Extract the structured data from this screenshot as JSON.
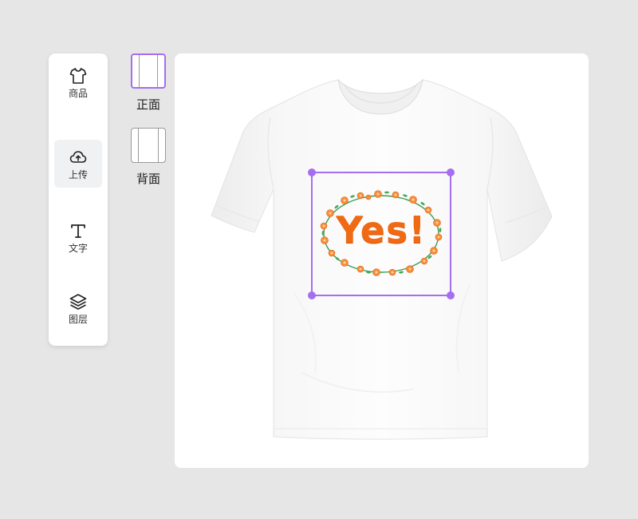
{
  "toolbar": {
    "items": [
      {
        "label": "商品",
        "icon": "tshirt-icon"
      },
      {
        "label": "上传",
        "icon": "cloud-upload-icon",
        "active": true
      },
      {
        "label": "文字",
        "icon": "text-icon"
      },
      {
        "label": "图层",
        "icon": "layers-icon"
      }
    ]
  },
  "sides": {
    "front_label": "正面",
    "back_label": "背面",
    "selected": "front"
  },
  "design": {
    "text": "Yes!",
    "text_color": "#f06a14"
  },
  "colors": {
    "accent": "#a56ef0",
    "background": "#e6e6e6"
  }
}
